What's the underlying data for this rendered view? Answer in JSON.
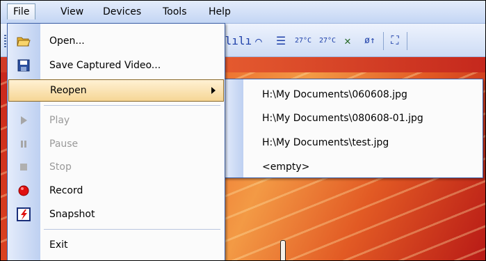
{
  "menubar": {
    "items": [
      {
        "label": "File"
      },
      {
        "label": "View"
      },
      {
        "label": "Devices"
      },
      {
        "label": "Tools"
      },
      {
        "label": "Help"
      }
    ]
  },
  "toolbar": {
    "icons": [
      "histogram-icon",
      "line-profile-icon",
      "table-icon",
      "temperature-c-icon",
      "temperature-select-icon",
      "delete-marks-icon",
      "emissivity-icon",
      "fullscreen-icon"
    ],
    "glyphs": [
      "ılılı",
      "⌒",
      "☰",
      "27°C",
      "27°C",
      "✕",
      "ø↑",
      "⛶"
    ]
  },
  "file_menu": {
    "items": [
      {
        "label": "Open...",
        "icon": "folder-open-icon",
        "enabled": true
      },
      {
        "label": "Save Captured Video...",
        "icon": "floppy-disk-icon",
        "enabled": true
      },
      {
        "label": "Reopen",
        "icon": "",
        "enabled": true,
        "has_submenu": true,
        "highlighted": true
      },
      {
        "label": "Play",
        "icon": "play-icon",
        "enabled": false
      },
      {
        "label": "Pause",
        "icon": "pause-icon",
        "enabled": false
      },
      {
        "label": "Stop",
        "icon": "stop-icon",
        "enabled": false
      },
      {
        "label": "Record",
        "icon": "record-icon",
        "enabled": true
      },
      {
        "label": "Snapshot",
        "icon": "snapshot-icon",
        "enabled": true
      },
      {
        "label": "Exit",
        "icon": "",
        "enabled": true
      }
    ]
  },
  "reopen_submenu": {
    "items": [
      "H:\\My Documents\\060608.jpg",
      "H:\\My Documents\\080608-01.jpg",
      "H:\\My Documents\\test.jpg",
      "<empty>"
    ]
  },
  "colors": {
    "menubar_bg": "#d3e0f7",
    "highlight": "#f6d695",
    "disabled_text": "#9a9a9a",
    "record_red": "#e01010"
  }
}
